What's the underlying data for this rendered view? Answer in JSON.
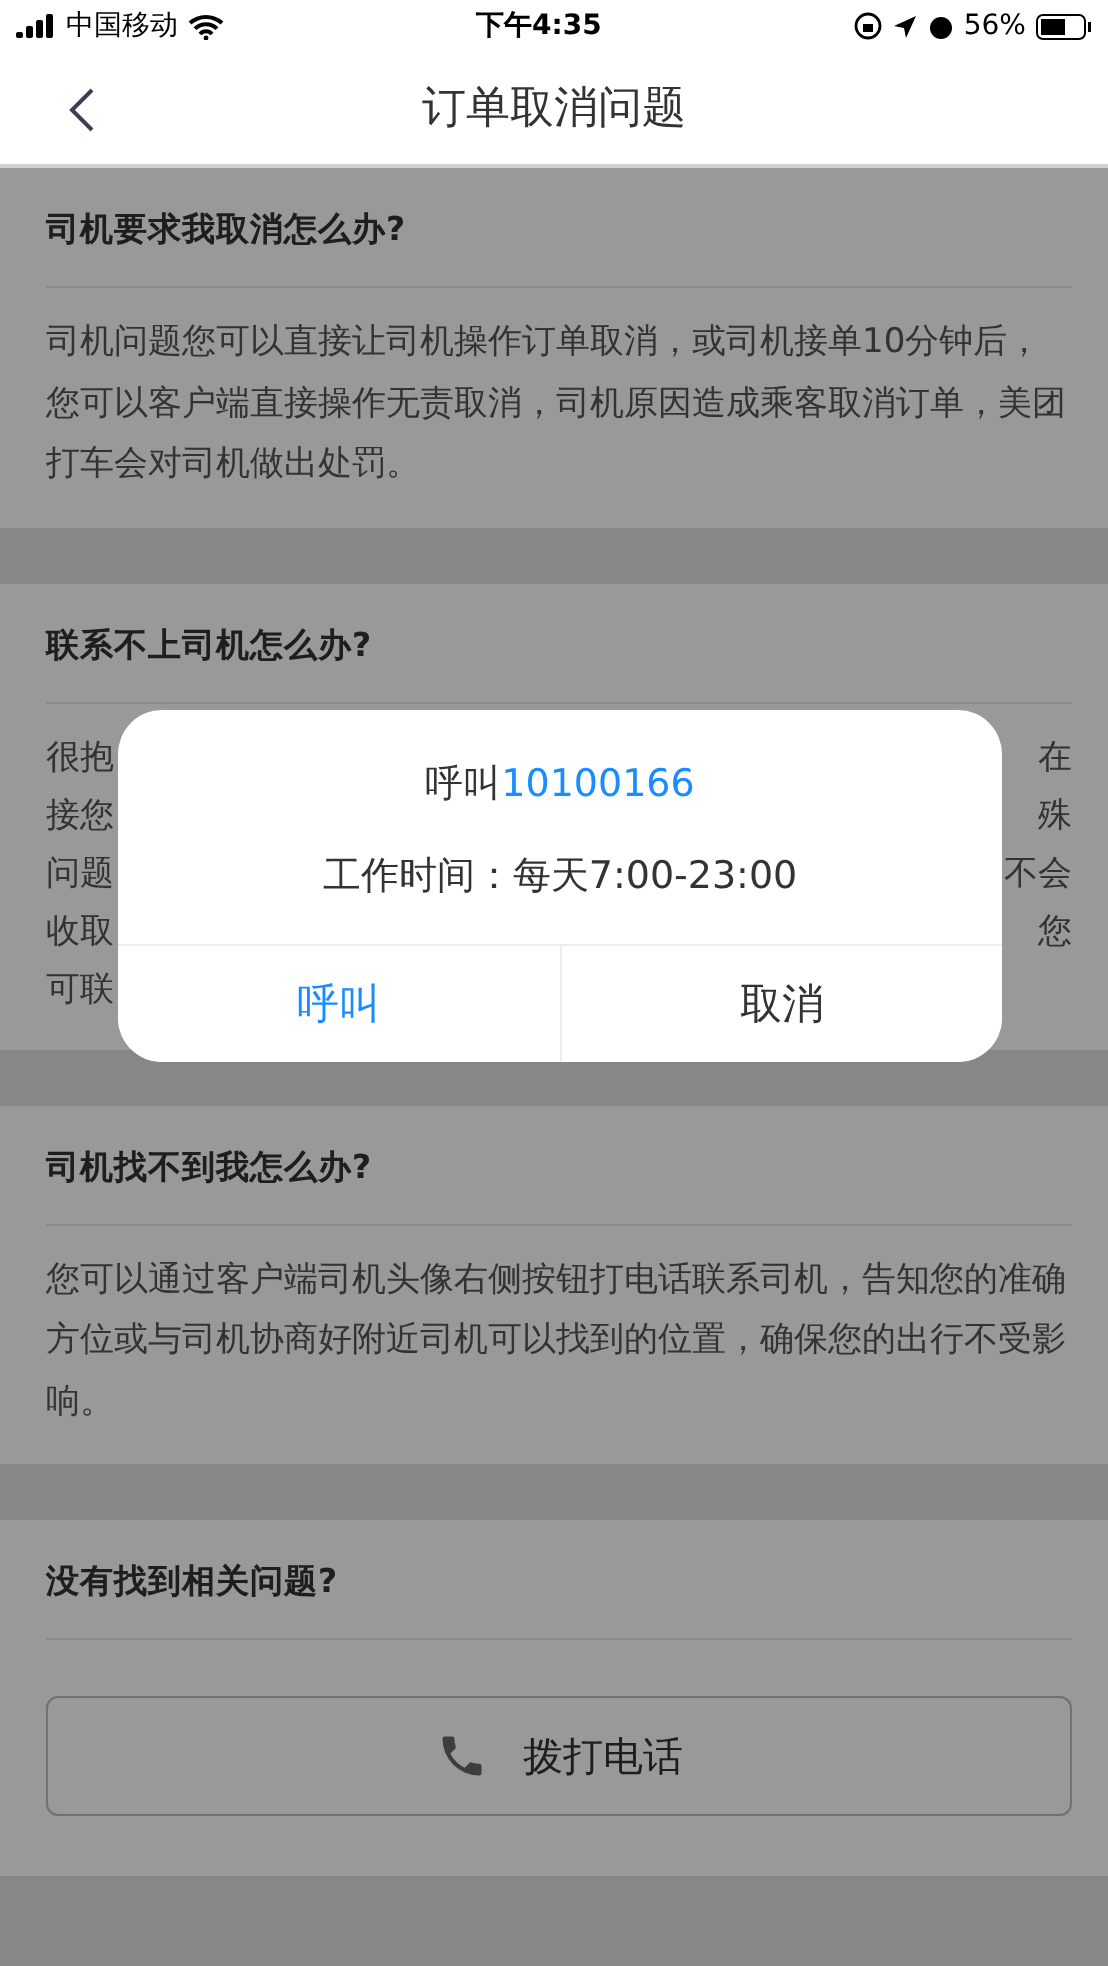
{
  "status_bar": {
    "carrier": "中国移动",
    "time": "下午4:35",
    "battery": "56%"
  },
  "nav": {
    "title": "订单取消问题"
  },
  "sections": [
    {
      "kind": "text",
      "title": "司机要求我取消怎么办?",
      "body": "司机问题您可以直接让司机操作订单取消，或司机接单10分钟后，您可以客户端直接操作无责取消，司机原因造成乘客取消订单，美团打车会对司机做出处罚。"
    },
    {
      "kind": "covered",
      "title": "联系不上司机怎么办?",
      "lines": [
        {
          "left": "很抱",
          "right": "在"
        },
        {
          "left": "接您",
          "right": "殊"
        },
        {
          "left": "问题",
          "right": "不会"
        },
        {
          "left": "收取",
          "right": "您"
        },
        {
          "left": "可联"
        }
      ]
    },
    {
      "kind": "text",
      "title": "司机找不到我怎么办?",
      "body": "您可以通过客户端司机头像右侧按钮打电话联系司机，告知您的准确方位或与司机协商好附近司机可以找到的位置，确保您的出行不受影响。"
    },
    {
      "kind": "action",
      "title": "没有找到相关问题?",
      "button": "拨打电话"
    }
  ],
  "dialog": {
    "prefix": "呼叫",
    "phone": "10100166",
    "hours": "工作时间：每天7:00-23:00",
    "buttons": [
      {
        "label": "呼叫",
        "primary": true
      },
      {
        "label": "取消",
        "primary": false
      }
    ]
  }
}
